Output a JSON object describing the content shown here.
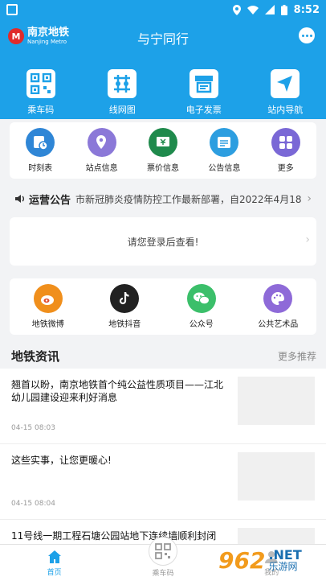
{
  "status_bar": {
    "time": "8:52"
  },
  "header": {
    "logo_cn": "南京地铁",
    "logo_en": "Nanjing Metro",
    "title": "与宁同行"
  },
  "top_nav": [
    {
      "label": "乘车码",
      "icon": "qr-code-icon"
    },
    {
      "label": "线网图",
      "icon": "network-map-icon"
    },
    {
      "label": "电子发票",
      "icon": "invoice-icon"
    },
    {
      "label": "站内导航",
      "icon": "navigation-icon"
    }
  ],
  "quick_menu": [
    {
      "label": "时刻表",
      "icon": "timetable-icon",
      "color": "#2f86d6"
    },
    {
      "label": "站点信息",
      "icon": "station-info-icon",
      "color": "#8b78d8"
    },
    {
      "label": "票价信息",
      "icon": "fare-info-icon",
      "color": "#1f8a4c"
    },
    {
      "label": "公告信息",
      "icon": "announcement-icon",
      "color": "#2d9ee0"
    },
    {
      "label": "更多",
      "icon": "more-apps-icon",
      "color": "#7a68d6"
    }
  ],
  "notice": {
    "label": "运营公告",
    "text": "市新冠肺炎疫情防控工作最新部署，自2022年4月18"
  },
  "login_prompt": "请您登录后查看!",
  "social": [
    {
      "label": "地铁微博",
      "icon": "weibo-icon",
      "color": "#f08f1c"
    },
    {
      "label": "地铁抖音",
      "icon": "douyin-icon",
      "color": "#222222"
    },
    {
      "label": "公众号",
      "icon": "wechat-icon",
      "color": "#3bbf6a"
    },
    {
      "label": "公共艺术品",
      "icon": "palette-icon",
      "color": "#8e6ad8"
    }
  ],
  "news": {
    "title": "地铁资讯",
    "more": "更多推荐",
    "items": [
      {
        "text": "翘首以盼，南京地铁首个纯公益性质项目——江北幼儿园建设迎来利好消息",
        "date": "04-15 08:03"
      },
      {
        "text": "这些实事，让您更暖心!",
        "date": "04-15 08:04"
      },
      {
        "text": "11号线一期工程石塘公园站地下连续墙顺利封闭",
        "date": ""
      }
    ]
  },
  "tabs": [
    {
      "label": "首页",
      "icon": "home-icon",
      "active": true
    },
    {
      "label": "乘车码",
      "icon": "qr-code-icon",
      "active": false
    },
    {
      "label": "我的",
      "icon": "profile-icon",
      "active": false
    }
  ],
  "watermark": {
    "num": "962",
    "net": ".NET",
    "cn": "乐游网"
  },
  "colors": {
    "primary": "#1da1e8",
    "logo_red": "#e02b2b"
  }
}
